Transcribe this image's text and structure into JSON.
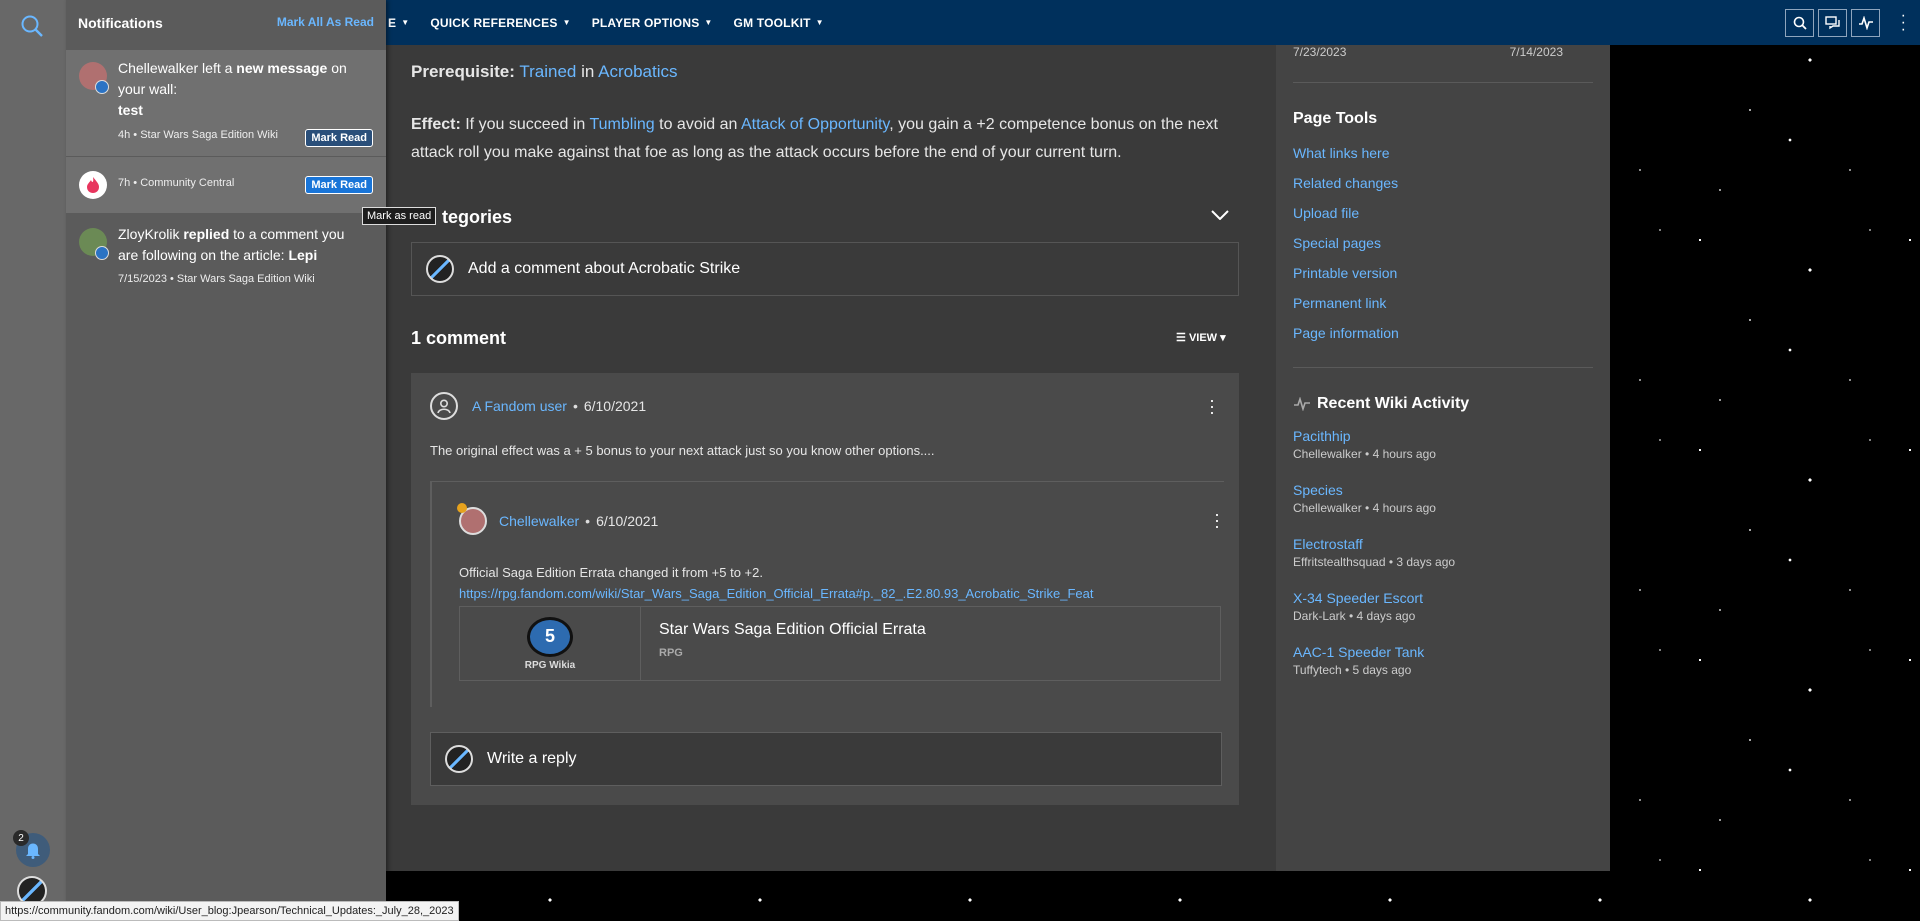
{
  "nav": {
    "items": [
      {
        "label": "E"
      },
      {
        "label": "QUICK REFERENCES"
      },
      {
        "label": "PLAYER OPTIONS"
      },
      {
        "label": "GM TOOLKIT"
      }
    ]
  },
  "article": {
    "prereq_label": "Prerequisite:",
    "prereq_link1": "Trained",
    "prereq_in": "in",
    "prereq_link2": "Acrobatics",
    "effect_label": "Effect:",
    "effect_1": "If you succeed in",
    "effect_link1": "Tumbling",
    "effect_2": "to avoid an",
    "effect_link2": "Attack of Opportunity",
    "effect_3": ", you gain a +2 competence bonus on the next attack roll you make against that foe as long as the attack occurs before the end of your current turn.",
    "categories_label": "tegories",
    "add_comment": "Add a comment about Acrobatic Strike",
    "comment_count": "1 comment",
    "view_label": "VIEW"
  },
  "comment": {
    "author": "A Fandom user",
    "date": "6/10/2021",
    "text": "The original effect was a + 5 bonus to your next attack just so you know other options....",
    "reply": {
      "author": "Chellewalker",
      "date": "6/10/2021",
      "text": "Official Saga Edition Errata changed it from +5 to +2.",
      "url": "https://rpg.fandom.com/wiki/Star_Wars_Saga_Edition_Official_Errata#p._82_.E2.80.93_Acrobatic_Strike_Feat",
      "embed": {
        "die": "5",
        "thumb_label": "RPG Wikia",
        "title": "Star Wars Saga Edition Official Errata",
        "subtitle": "RPG"
      }
    },
    "write_reply": "Write a reply"
  },
  "rail": {
    "date_left": "7/23/2023",
    "date_right": "7/14/2023",
    "page_tools_title": "Page Tools",
    "page_tools": [
      "What links here",
      "Related changes",
      "Upload file",
      "Special pages",
      "Printable version",
      "Permanent link",
      "Page information"
    ],
    "activity_title": "Recent Wiki Activity",
    "activity": [
      {
        "title": "Pacithhip",
        "meta": "Chellewalker • 4 hours ago"
      },
      {
        "title": "Species",
        "meta": "Chellewalker • 4 hours ago"
      },
      {
        "title": "Electrostaff",
        "meta": "Effritstealthsquad • 3 days ago"
      },
      {
        "title": "X-34 Speeder Escort",
        "meta": "Dark-Lark • 4 days ago"
      },
      {
        "title": "AAC-1 Speeder Tank",
        "meta": "Tuffytech • 5 days ago"
      }
    ]
  },
  "notifications": {
    "title": "Notifications",
    "mark_all": "Mark All As Read",
    "items": [
      {
        "user": "Chellewalker",
        "action1": "left a",
        "action_bold": "new message",
        "action2": "on your wall:",
        "extra": "test",
        "meta": "4h • Star Wars Saga Edition Wiki",
        "button": "Mark Read"
      },
      {
        "meta": "7h • Community Central",
        "button": "Mark Read"
      },
      {
        "user": "ZloyKrolik",
        "action_bold": "replied",
        "action2": "to a comment you are following on the article:",
        "article": "Lepi",
        "meta": "7/15/2023 • Star Wars Saga Edition Wiki"
      }
    ],
    "tooltip": "Mark as read"
  },
  "sidebar": {
    "badge_count": "2"
  },
  "status_url": "https://community.fandom.com/wiki/User_blog:Jpearson/Technical_Updates:_July_28,_2023",
  "colors": {
    "nav": "#00305c",
    "link": "#6ab7ff",
    "accent": "#1975d8"
  }
}
